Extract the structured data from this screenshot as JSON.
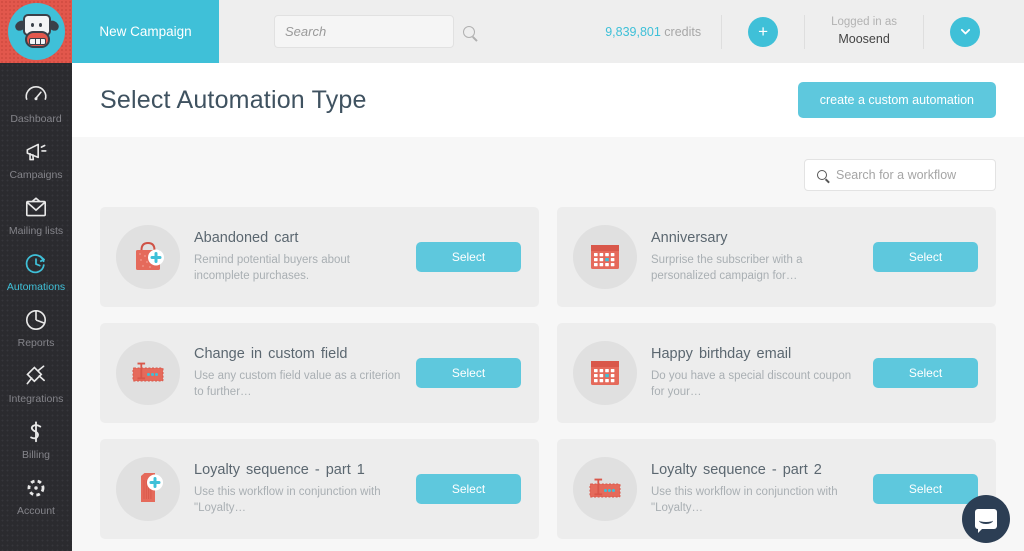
{
  "topbar": {
    "logo_alt": "Moosend cow logo",
    "new_campaign_label": "New Campaign",
    "search_placeholder": "Search",
    "search_value": "",
    "credits_amount": "9,839,801",
    "credits_label": "credits",
    "add_button_glyph": "+",
    "logged_in_label": "Logged in as",
    "account_name": "Moosend",
    "dropdown_glyph": "❯"
  },
  "sidebar": {
    "items": [
      {
        "label": "Dashboard",
        "icon": "gauge-icon",
        "active": false
      },
      {
        "label": "Campaigns",
        "icon": "megaphone-icon",
        "active": false
      },
      {
        "label": "Mailing lists",
        "icon": "envelope-icon",
        "active": false
      },
      {
        "label": "Automations",
        "icon": "clock-arrow-icon",
        "active": true
      },
      {
        "label": "Reports",
        "icon": "pie-chart-icon",
        "active": false
      },
      {
        "label": "Integrations",
        "icon": "plug-icon",
        "active": false
      },
      {
        "label": "Billing",
        "icon": "dollar-icon",
        "active": false
      },
      {
        "label": "Account",
        "icon": "gear-icon",
        "active": false
      }
    ]
  },
  "page": {
    "title": "Select Automation Type",
    "custom_automation_label": "create a custom automation",
    "workflow_search_placeholder": "Search for a workflow",
    "workflow_search_value": ""
  },
  "cards": [
    {
      "title": "Abandoned  cart",
      "desc": "Remind potential buyers about incomplete purchases.",
      "icon": "shopping-bag-plus-icon",
      "select_label": "Select"
    },
    {
      "title": "Anniversary",
      "desc": "Surprise the subscriber with a personalized campaign for…",
      "icon": "calendar-icon",
      "select_label": "Select"
    },
    {
      "title": "Change in custom field",
      "desc": "Use any custom field value as a criterion to further…",
      "icon": "text-field-icon",
      "select_label": "Select"
    },
    {
      "title": "Happy birthday email",
      "desc": "Do you have a special discount coupon for your…",
      "icon": "calendar-icon",
      "select_label": "Select"
    },
    {
      "title": "Loyalty sequence - part 1",
      "desc": "Use this workflow in conjunction with \"Loyalty…",
      "icon": "price-tag-plus-icon",
      "select_label": "Select"
    },
    {
      "title": "Loyalty sequence - part 2",
      "desc": "Use this workflow in conjunction with \"Loyalty…",
      "icon": "text-field-icon",
      "select_label": "Select"
    }
  ],
  "chat": {
    "launcher_name": "Intercom chat launcher"
  },
  "colors": {
    "brand_teal": "#3fc0d8",
    "button_teal": "#5ec8dd",
    "logo_red": "#e2574c",
    "sidebar_dark": "#2b2b2f",
    "title_slate": "#3f5260",
    "chat_navy": "#2c3e54"
  }
}
